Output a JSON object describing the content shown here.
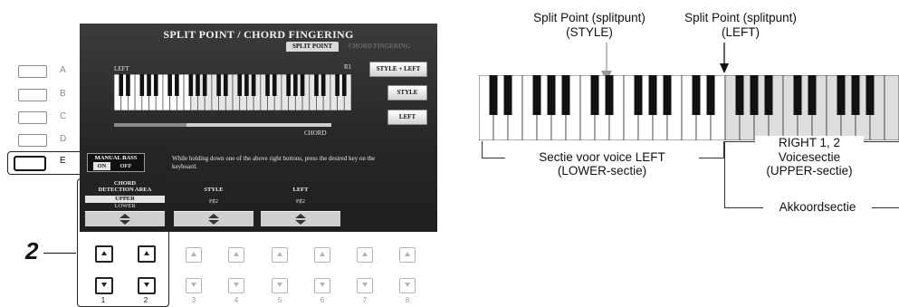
{
  "display": {
    "title": "SPLIT POINT / CHORD FINGERING",
    "tab_active": "SPLIT POINT",
    "tab_inactive": "CHORD FINGERING",
    "label_left": "LEFT",
    "label_r1": "R1",
    "label_chord": "CHORD",
    "buttons": {
      "style_left": "STYLE + LEFT",
      "style": "STYLE",
      "left": "LEFT"
    },
    "message": "While holding down one of the above right buttons, press the desired key on the keyboard.",
    "manual_bass": {
      "label": "MANUAL BASS",
      "on": "ON",
      "off": "OFF"
    },
    "columns": {
      "chord_detection": {
        "head_line1": "CHORD",
        "head_line2": "DETECTION AREA",
        "selected": "UPPER",
        "other": "LOWER"
      },
      "style": {
        "head": "STYLE",
        "value": "F♯2"
      },
      "left": {
        "head": "LEFT",
        "value": "F♯2"
      }
    }
  },
  "side_buttons": [
    "A",
    "B",
    "C",
    "D",
    "E"
  ],
  "step_number": "2",
  "bottom_buttons": [
    "1",
    "2",
    "3",
    "4",
    "5",
    "6",
    "7",
    "8"
  ],
  "diagram": {
    "split_style_caption_line1": "Split Point (splitpunt)",
    "split_style_caption_line2": "(STYLE)",
    "split_left_caption_line1": "Split Point (splitpunt)",
    "split_left_caption_line2": "(LEFT)",
    "left_section_line1": "Sectie voor voice LEFT",
    "left_section_line2": "(LOWER-sectie)",
    "right_section_line1": "RIGHT 1, 2",
    "right_section_line2": "Voicesectie",
    "right_section_line3": "(UPPER-sectie)",
    "chord_section": "Akkoordsectie"
  }
}
